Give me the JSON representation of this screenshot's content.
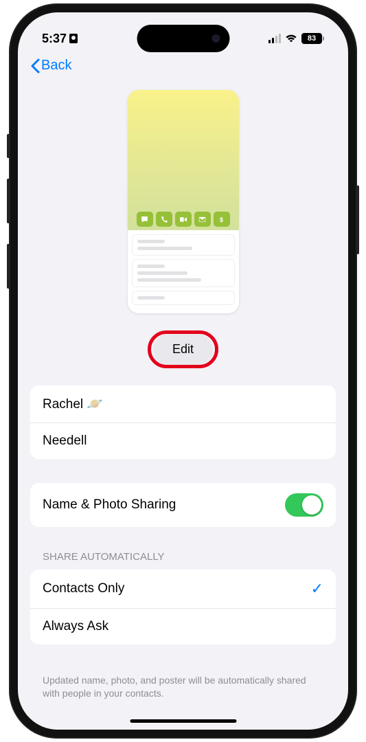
{
  "status": {
    "time": "5:37",
    "battery": "83"
  },
  "nav": {
    "back": "Back"
  },
  "edit": {
    "label": "Edit"
  },
  "name": {
    "first": "Rachel 🪐",
    "last": "Needell"
  },
  "sharing": {
    "label": "Name & Photo Sharing"
  },
  "share_auto": {
    "header": "SHARE AUTOMATICALLY",
    "options": [
      {
        "label": "Contacts Only",
        "selected": true
      },
      {
        "label": "Always Ask",
        "selected": false
      }
    ],
    "footer": "Updated name, photo, and poster will be automatically shared with people in your contacts."
  }
}
